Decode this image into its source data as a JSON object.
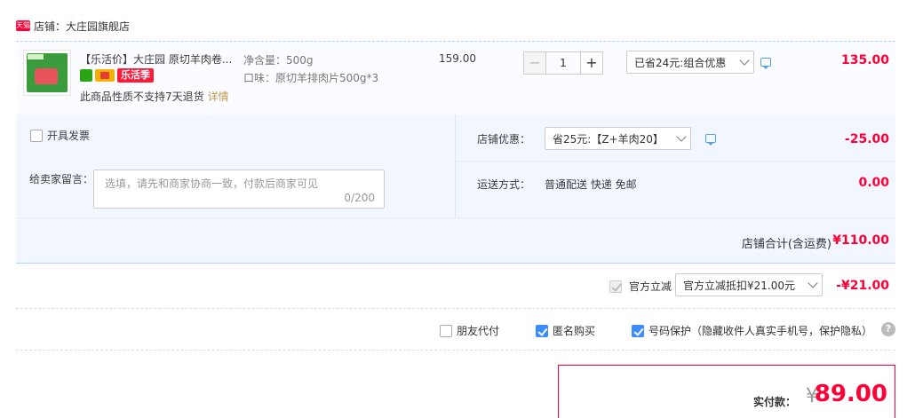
{
  "shop": {
    "badge": "天猫",
    "name": "店铺：大庄园旗舰店"
  },
  "item": {
    "title": "【乐活价】大庄园 原切羊肉卷...",
    "badge_label": "乐活季",
    "no_return_text": "此商品性质不支持7天退货",
    "detail_link": "详情",
    "spec_weight": "净含量：500g",
    "spec_flavor": "口味：原切羊排肉片500g*3",
    "unit_price": "159.00",
    "quantity": "1",
    "minus": "−",
    "plus": "+",
    "discount_option": "已省24元:组合优惠",
    "total": "135.00"
  },
  "invoice": {
    "label": "开具发票",
    "checked": false
  },
  "memo": {
    "label": "给卖家留言：",
    "placeholder": "选填，请先和商家协商一致，付款后商家可见",
    "counter": "0/200"
  },
  "shop_discount": {
    "label": "店铺优惠：",
    "option": "省25元:【Z+羊肉20】",
    "value": "-25.00"
  },
  "shipping": {
    "label": "运送方式：",
    "method": "普通配送 快递 免邮",
    "value": "0.00"
  },
  "subtotal": {
    "label": "店铺合计(含运费)",
    "value": "¥110.00"
  },
  "official": {
    "label": "官方立减",
    "option": "官方立减抵扣¥21.00元",
    "value": "-¥21.00"
  },
  "options": [
    {
      "label": "朋友代付",
      "checked": false
    },
    {
      "label": "匿名购买",
      "checked": true
    },
    {
      "label": "号码保护（隐藏收件人真实手机号，保护隐私）",
      "checked": true
    }
  ],
  "help_icon": "?",
  "payment": {
    "label": "实付款：",
    "currency": "¥",
    "amount": "89.00"
  },
  "colors": {
    "accent": "#ff0036",
    "link_blue": "#3b8cff",
    "panel_bg": "#f2f7ff"
  }
}
